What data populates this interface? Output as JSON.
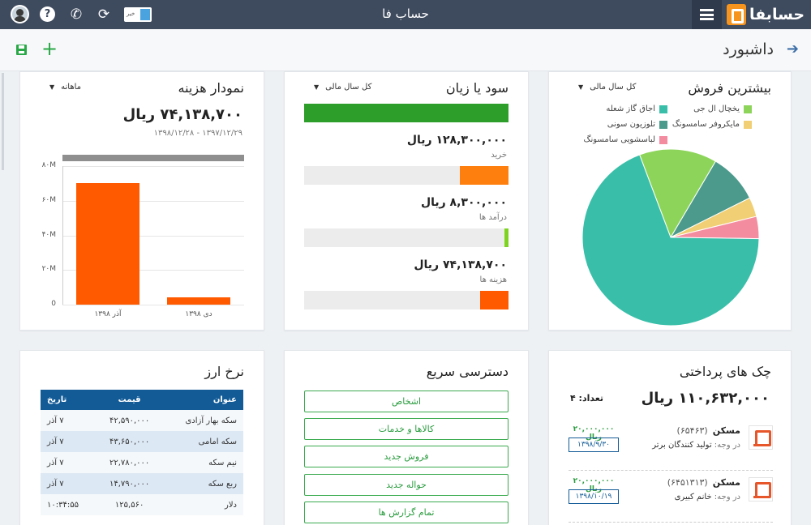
{
  "header": {
    "app_title": "حساب فا",
    "toggle_label": "خیر",
    "logo_text": "حسابفا"
  },
  "subheader": {
    "page_title": "داشبورد"
  },
  "expense_chart": {
    "title": "نمودار هزینه",
    "period": "ماهانه",
    "amount": "۷۴,۱۳۸,۷۰۰ ریال",
    "date_range": "۱۳۹۷/۱۲/۲۹ - ۱۳۹۸/۱۲/۲۸",
    "y_ticks": [
      "۸۰M",
      "۶۰M",
      "۴۰M",
      "۲۰M",
      "0"
    ]
  },
  "chart_data": [
    {
      "type": "bar",
      "title": "نمودار هزینه",
      "categories": [
        "آذر ۱۳۹۸",
        "دی ۱۳۹۸"
      ],
      "values": [
        70,
        4
      ],
      "units": "M",
      "ylim": [
        0,
        80
      ],
      "grid": true
    },
    {
      "type": "pie",
      "title": "بیشترین فروش",
      "labels": [
        "یخچال ال جی",
        "اجاق گاز شعله",
        "مایکروفر سامسونگ",
        "تلوزیون سونی",
        "لباسشویی سامسونگ"
      ],
      "values": [
        14,
        68,
        3.5,
        9,
        4
      ],
      "colors": [
        "#8dd55a",
        "#39bfa9",
        "#f1cf74",
        "#4b9a8c",
        "#f48ca0"
      ],
      "legend": "top"
    }
  ],
  "profit": {
    "title": "سود یا زیان",
    "period": "کل سال مالی",
    "top_bar_color": "#2e9e2a",
    "rows": [
      {
        "amount": "۱۲۸,۳۰۰,۰۰۰ ریال",
        "label": "خرید",
        "fraction": 0.24,
        "color": "#ff7f0e"
      },
      {
        "amount": "۸,۳۰۰,۰۰۰ ریال",
        "label": "درآمد ها",
        "fraction": 0.02,
        "color": "#7ed321"
      },
      {
        "amount": "۷۴,۱۳۸,۷۰۰ ریال",
        "label": "هزینه ها",
        "fraction": 0.14,
        "color": "#ff5a00"
      }
    ]
  },
  "sales": {
    "title": "بیشترین فروش",
    "period": "کل سال مالی"
  },
  "currency": {
    "title": "نرخ ارز",
    "headers": [
      "عنوان",
      "قیمت",
      "تاریخ"
    ],
    "rows": [
      [
        "سکه بهار آزادی",
        "۴۲,۵۹۰,۰۰۰",
        "۷ آذر"
      ],
      [
        "سکه امامی",
        "۴۳,۶۵۰,۰۰۰",
        "۷ آذر"
      ],
      [
        "نیم سکه",
        "۲۲,۷۸۰,۰۰۰",
        "۷ آذر"
      ],
      [
        "ربع سکه",
        "۱۴,۷۹۰,۰۰۰",
        "۷ آذر"
      ],
      [
        "دلار",
        "۱۲۵,۵۶۰",
        "۱۰:۳۴:۵۵"
      ]
    ]
  },
  "quick_access": {
    "title": "دسترسی سریع",
    "buttons": [
      "اشخاص",
      "کالاها و خدمات",
      "فروش جدید",
      "حواله جدید",
      "تمام گزارش ها"
    ]
  },
  "checks": {
    "title": "چک های پرداختی",
    "total": "۱۱۰,۶۳۲,۰۰۰ ریال",
    "count": "تعداد: ۴",
    "items": [
      {
        "name": "مسکن",
        "number": "(۶۵۴۶۳)",
        "payee_label": "در وجه:",
        "payee": "تولید کنندگان برتر",
        "amount": "۲۰,۰۰۰,۰۰۰ ریال",
        "date": "۱۳۹۸/۹/۳۰"
      },
      {
        "name": "مسکن",
        "number": "(۶۴۵۱۳۱۳)",
        "payee_label": "در وجه:",
        "payee": "خانم کبیری",
        "amount": "۲۰,۰۰۰,۰۰۰ ریال",
        "date": "۱۳۹۸/۱۰/۱۹"
      }
    ]
  },
  "icons": {
    "help": "help-icon",
    "phone": "phone-icon",
    "refresh": "refresh-icon",
    "menu": "menu-icon",
    "save": "save-icon",
    "add": "add-icon",
    "back": "arrow-right-icon"
  }
}
